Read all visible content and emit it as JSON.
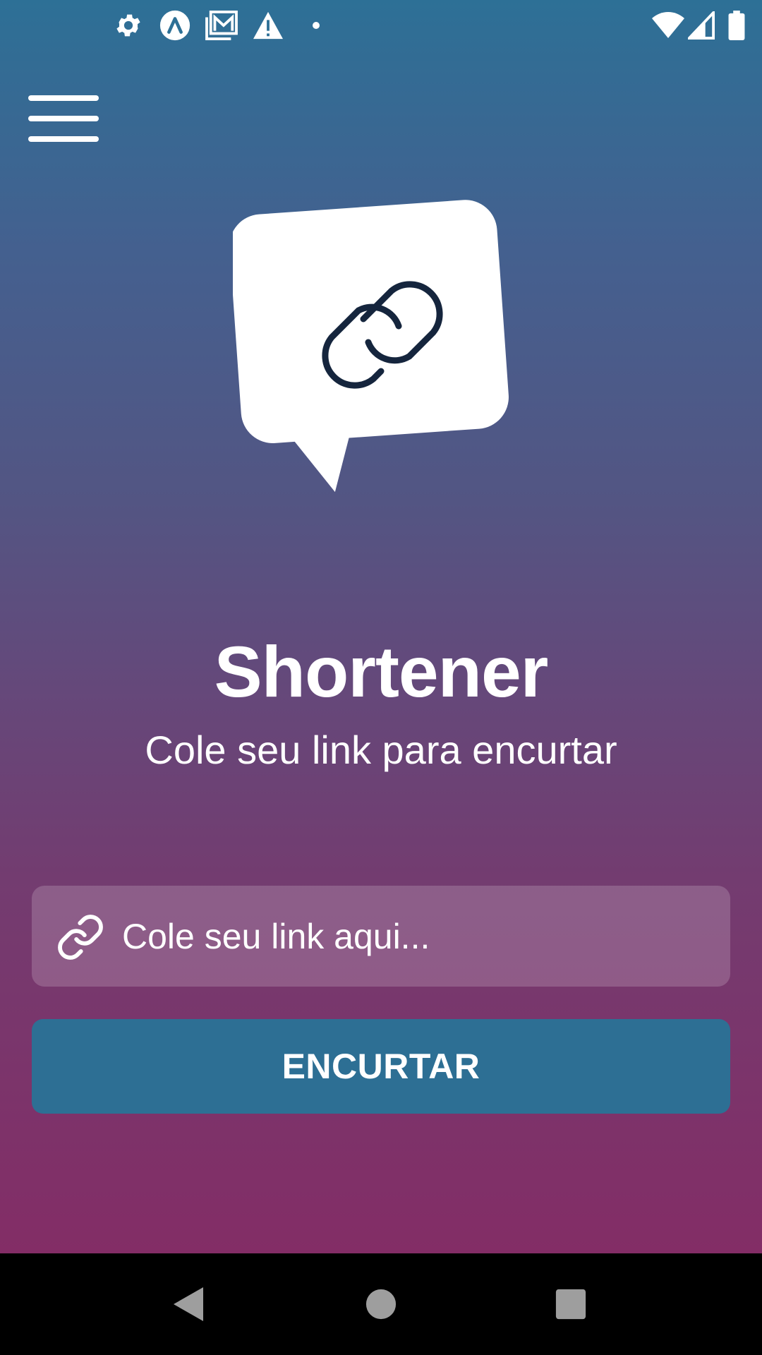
{
  "status_bar": {
    "left_icons": [
      "gear-icon",
      "expo-icon",
      "gallery-mail-icon",
      "warning-icon",
      "dot-icon"
    ],
    "right_icons": [
      "wifi-icon",
      "signal-icon",
      "battery-icon"
    ]
  },
  "app": {
    "title": "Shortener",
    "subtitle": "Cole seu link para encurtar",
    "menu_icon": "hamburger-menu-icon",
    "logo_icon": "link-chat-bubble-logo"
  },
  "form": {
    "input_placeholder": "Cole seu link aqui...",
    "input_value": "",
    "input_icon": "link-icon",
    "button_label": "ENCURTAR"
  },
  "nav_bar": {
    "buttons": [
      "back-icon",
      "home-icon",
      "recents-icon"
    ]
  },
  "colors": {
    "gradient_top": "#2d7096",
    "gradient_bottom": "#832d66",
    "button": "#2d6f94",
    "logo_link_stroke": "#15253d"
  }
}
